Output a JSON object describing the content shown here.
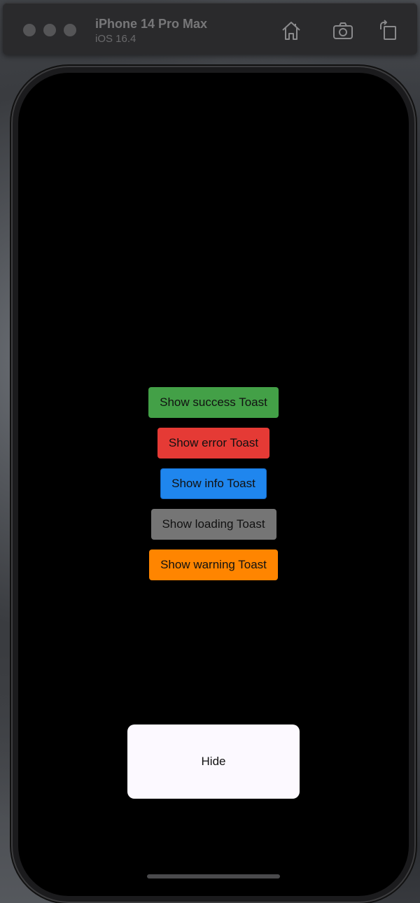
{
  "simulator": {
    "device_name": "iPhone 14 Pro Max",
    "os_version": "iOS 16.4",
    "icons": [
      "home-icon",
      "screenshot-icon",
      "rotate-icon"
    ]
  },
  "app": {
    "buttons": [
      {
        "label": "Show success Toast",
        "color": "#43a047"
      },
      {
        "label": "Show error Toast",
        "color": "#e53a35"
      },
      {
        "label": "Show info Toast",
        "color": "#1f86ee"
      },
      {
        "label": "Show loading Toast",
        "color": "#757575"
      },
      {
        "label": "Show warning Toast",
        "color": "#ff8500"
      }
    ],
    "hide_label": "Hide"
  }
}
